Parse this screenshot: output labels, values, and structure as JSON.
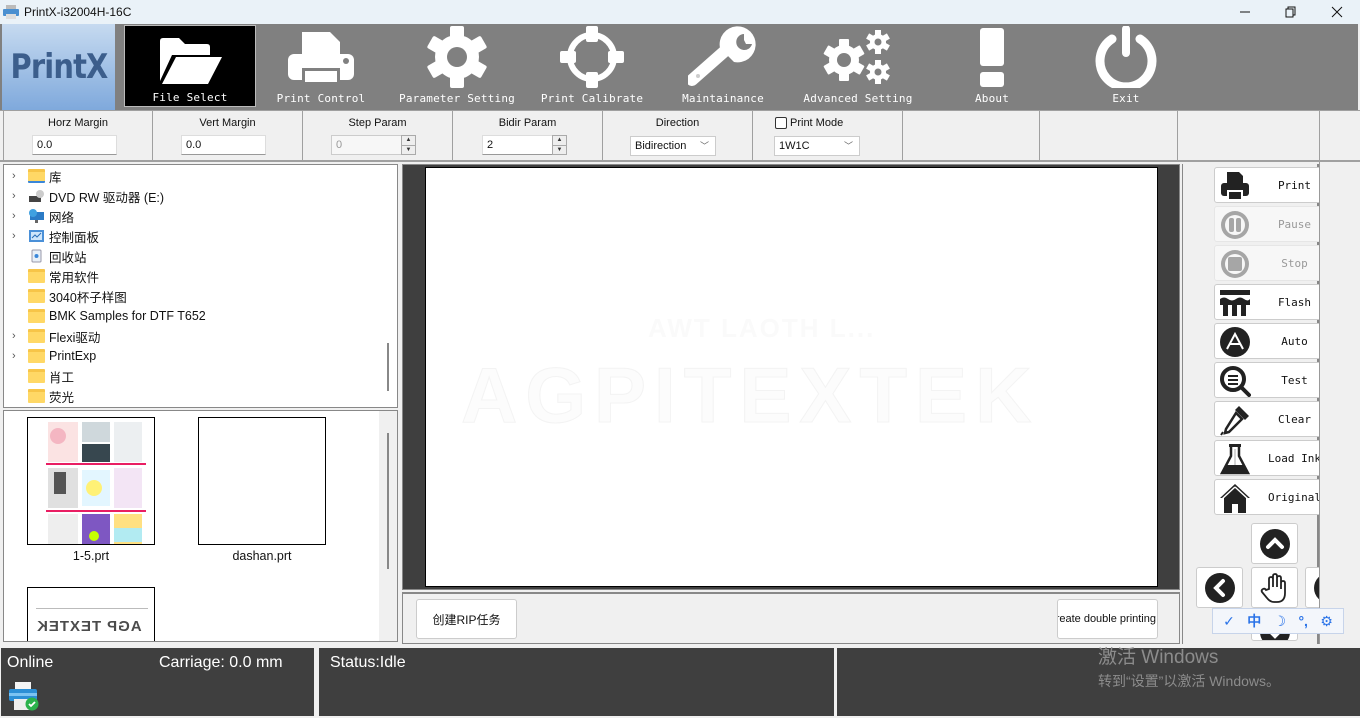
{
  "window": {
    "title": "PrintX-i32004H-16C",
    "controls": [
      "minimize",
      "restore",
      "close"
    ]
  },
  "logo": {
    "text": "PrintX"
  },
  "toolbar": {
    "items": [
      {
        "label": "File Select",
        "icon": "folder-open-icon",
        "active": true
      },
      {
        "label": "Print Control",
        "icon": "printer-icon",
        "active": false
      },
      {
        "label": "Parameter Setting",
        "icon": "gear-icon",
        "active": false
      },
      {
        "label": "Print Calibrate",
        "icon": "crosshair-icon",
        "active": false
      },
      {
        "label": "Maintainance",
        "icon": "wrench-icon",
        "active": false
      },
      {
        "label": "Advanced Setting",
        "icon": "gears-icon",
        "active": false
      },
      {
        "label": "About",
        "icon": "exclamation-icon",
        "active": false
      },
      {
        "label": "Exit",
        "icon": "power-icon",
        "active": false
      }
    ]
  },
  "params": {
    "horz_margin": {
      "label": "Horz Margin",
      "value": "0.0"
    },
    "vert_margin": {
      "label": "Vert Margin",
      "value": "0.0"
    },
    "step_param": {
      "label": "Step Param",
      "value": "0",
      "disabled": true
    },
    "bidir_param": {
      "label": "Bidir Param",
      "value": "2"
    },
    "direction": {
      "label": "Direction",
      "value": "Bidirection"
    },
    "print_mode": {
      "label": "Print Mode",
      "checked": false,
      "value": "1W1C"
    }
  },
  "tree": {
    "items": [
      {
        "label": "库",
        "icon": "library-folder-icon",
        "expandable": true
      },
      {
        "label": "DVD RW 驱动器 (E:)",
        "icon": "dvd-drive-icon",
        "expandable": true
      },
      {
        "label": "网络",
        "icon": "network-icon",
        "expandable": true
      },
      {
        "label": "控制面板",
        "icon": "control-panel-icon",
        "expandable": true
      },
      {
        "label": "回收站",
        "icon": "recycle-bin-icon",
        "expandable": false
      },
      {
        "label": "常用软件",
        "icon": "folder-icon",
        "expandable": false
      },
      {
        "label": "3040杯子样图",
        "icon": "folder-icon",
        "expandable": false
      },
      {
        "label": "BMK Samples for DTF T652",
        "icon": "folder-icon",
        "expandable": false
      },
      {
        "label": "Flexi驱动",
        "icon": "folder-icon",
        "expandable": true
      },
      {
        "label": "PrintExp",
        "icon": "folder-icon",
        "expandable": true
      },
      {
        "label": "肖工",
        "icon": "folder-icon",
        "expandable": false
      },
      {
        "label": "荧光",
        "icon": "folder-icon",
        "expandable": false
      }
    ]
  },
  "thumbnails": [
    {
      "label": "1-5.prt"
    },
    {
      "label": "dashan.prt"
    },
    {
      "label": "AGP TEXTEK"
    }
  ],
  "preview": {
    "ghost_line1": "AWT LAOTH L...",
    "ghost_line2": "AGPITEXTEK"
  },
  "actions": {
    "create_rip": "创建RIP任务",
    "create_double": "Create double printing"
  },
  "side_buttons": [
    {
      "label": "Print",
      "icon": "printer-icon",
      "disabled": false
    },
    {
      "label": "Pause",
      "icon": "pause-icon",
      "disabled": true
    },
    {
      "label": "Stop",
      "icon": "stop-icon",
      "disabled": true
    },
    {
      "label": "Flash",
      "icon": "flash-nozzle-icon",
      "disabled": false
    },
    {
      "label": "Auto",
      "icon": "auto-icon",
      "disabled": false
    },
    {
      "label": "Test",
      "icon": "magnifier-icon",
      "disabled": false
    },
    {
      "label": "Clear",
      "icon": "dropper-icon",
      "disabled": false
    },
    {
      "label": "Load Ink",
      "icon": "flask-icon",
      "disabled": false
    },
    {
      "label": "Original",
      "icon": "home-icon",
      "disabled": false
    }
  ],
  "nav": [
    "up",
    "left",
    "hand",
    "right",
    "down"
  ],
  "ime": [
    "✓",
    "中",
    "☽",
    "°,",
    "⚙"
  ],
  "status": {
    "connection": "Online",
    "carriage": "Carriage: 0.0 mm",
    "state": "Status:Idle"
  },
  "watermark": {
    "line1": "激活 Windows",
    "line2": "转到“设置”以激活 Windows。"
  },
  "colors": {
    "toolbar_bg": "#808080",
    "active_tab": "#000000",
    "status_bg": "#3f3f3f",
    "ime_accent": "#2a73e8"
  }
}
